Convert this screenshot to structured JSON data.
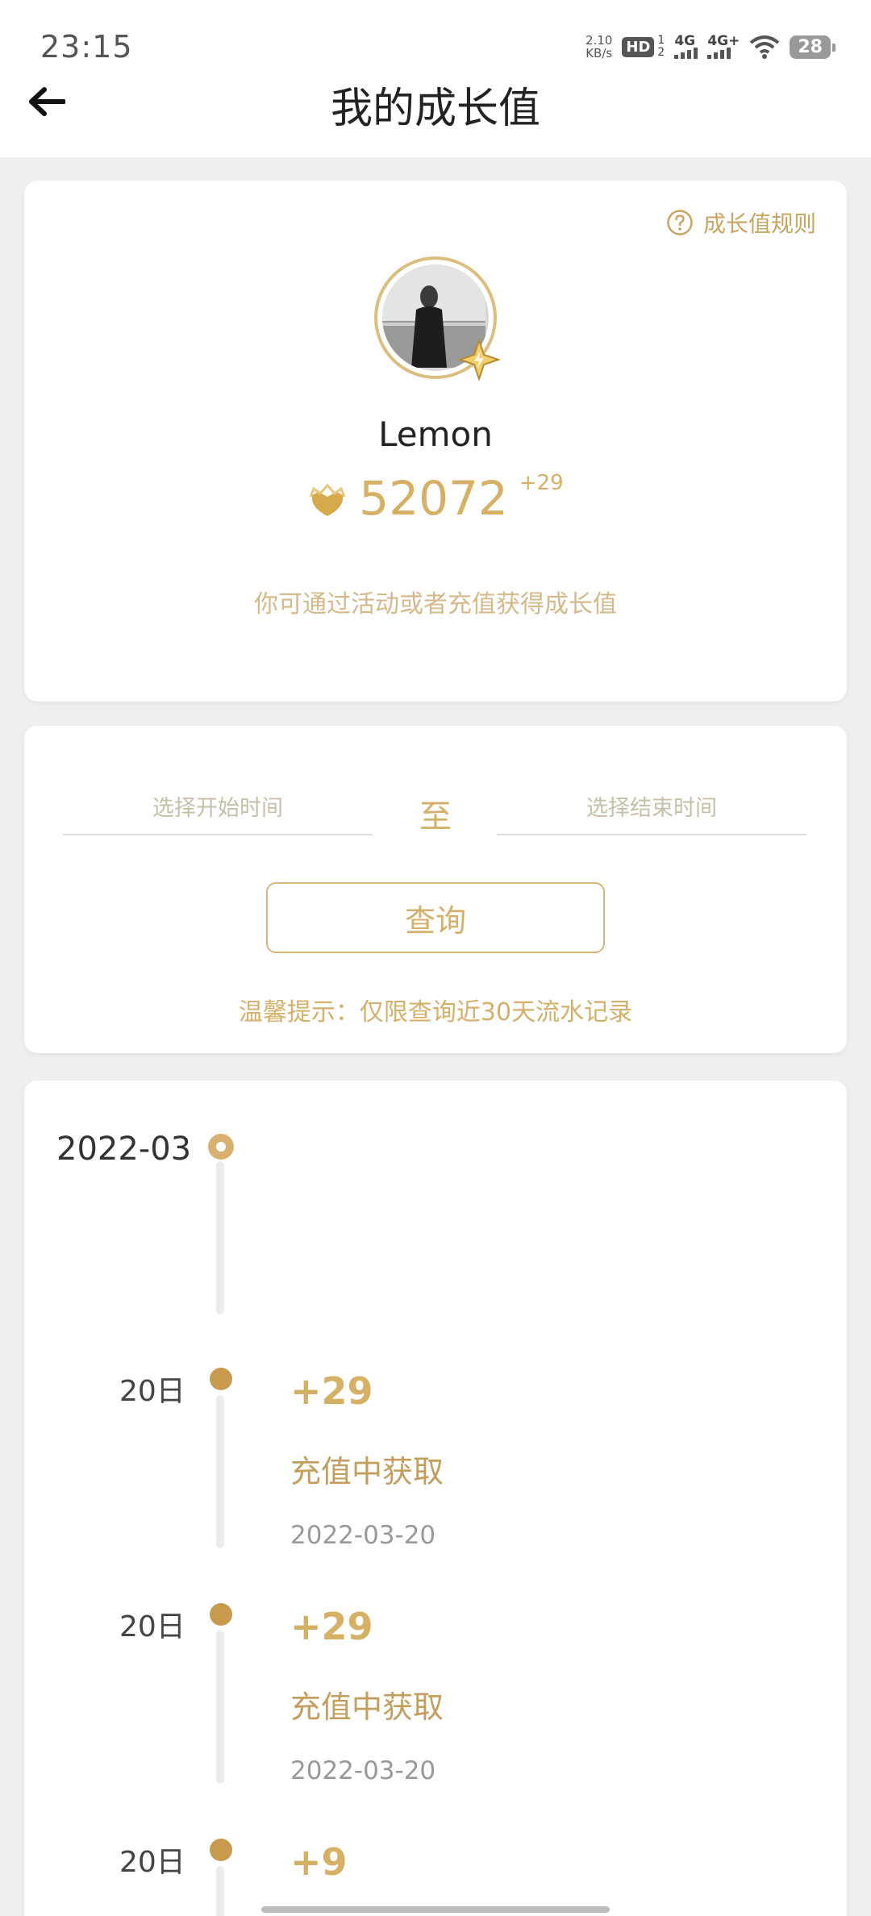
{
  "status_bar": {
    "time": "23:15",
    "net_speed_value": "2.10",
    "net_speed_unit": "KB/s",
    "hd_label": "HD",
    "hd_sub_top": "1",
    "hd_sub_bottom": "2",
    "network1": "4G",
    "network2": "4G+",
    "battery": "28"
  },
  "nav": {
    "title": "我的成长值",
    "back_icon": "arrow-left-icon"
  },
  "profile_card": {
    "rules_link": "成长值规则",
    "rules_icon": "help-circle-icon",
    "username": "Lemon",
    "score": "52072",
    "score_delta": "+29",
    "hint": "你可通过活动或者充值获得成长值"
  },
  "query_card": {
    "start_placeholder": "选择开始时间",
    "to_label": "至",
    "end_placeholder": "选择结束时间",
    "query_button": "查询",
    "tip": "温馨提示：仅限查询近30天流水记录"
  },
  "timeline": {
    "month": "2022-03",
    "records": [
      {
        "day": "20日",
        "amount": "+29",
        "source": "充值中获取",
        "date": "2022-03-20"
      },
      {
        "day": "20日",
        "amount": "+29",
        "source": "充值中获取",
        "date": "2022-03-20"
      },
      {
        "day": "20日",
        "amount": "+9"
      }
    ]
  },
  "colors": {
    "accent": "#d6b065",
    "background": "#efefef"
  }
}
